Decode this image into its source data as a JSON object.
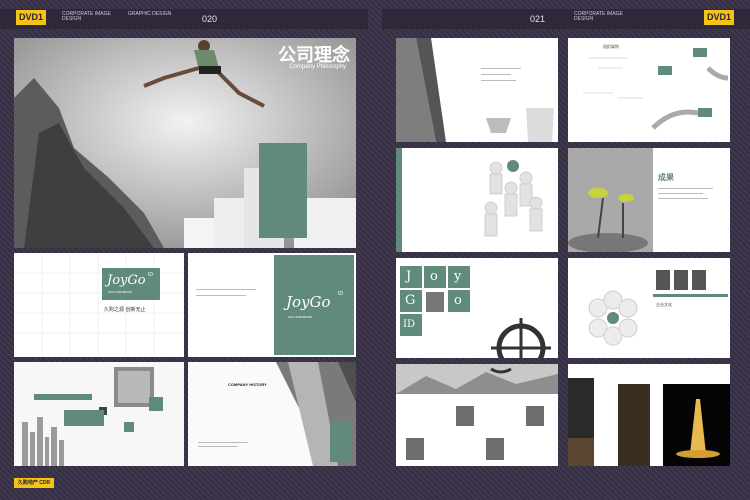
{
  "header": {
    "left_badge": "DVD1",
    "right_badge": "DVD1",
    "left_page": "020",
    "right_page": "021",
    "left_caption_1": "CORPORATE IMAGE DESIGN",
    "left_caption_2": "GRAPHIC DESIGN",
    "right_caption": "CORPORATE IMAGE DESIGN"
  },
  "hero": {
    "title": "公司理念",
    "subtitle": "Company Philosophy"
  },
  "brand": {
    "logo": "JoyGo",
    "logo_sup": "ID",
    "logo_sub": "GAO STENBOOK",
    "tagline": "久购之源 创新无止"
  },
  "joy_grid": [
    "J",
    "o",
    "y",
    "G",
    "o",
    "ID"
  ],
  "thumb_labels": {
    "achievement": "成果",
    "company_history": "COMPANY HISTORY",
    "structure": "组织架构",
    "culture": "企业文化"
  },
  "footer": {
    "tag": "久购地产 CDR"
  }
}
